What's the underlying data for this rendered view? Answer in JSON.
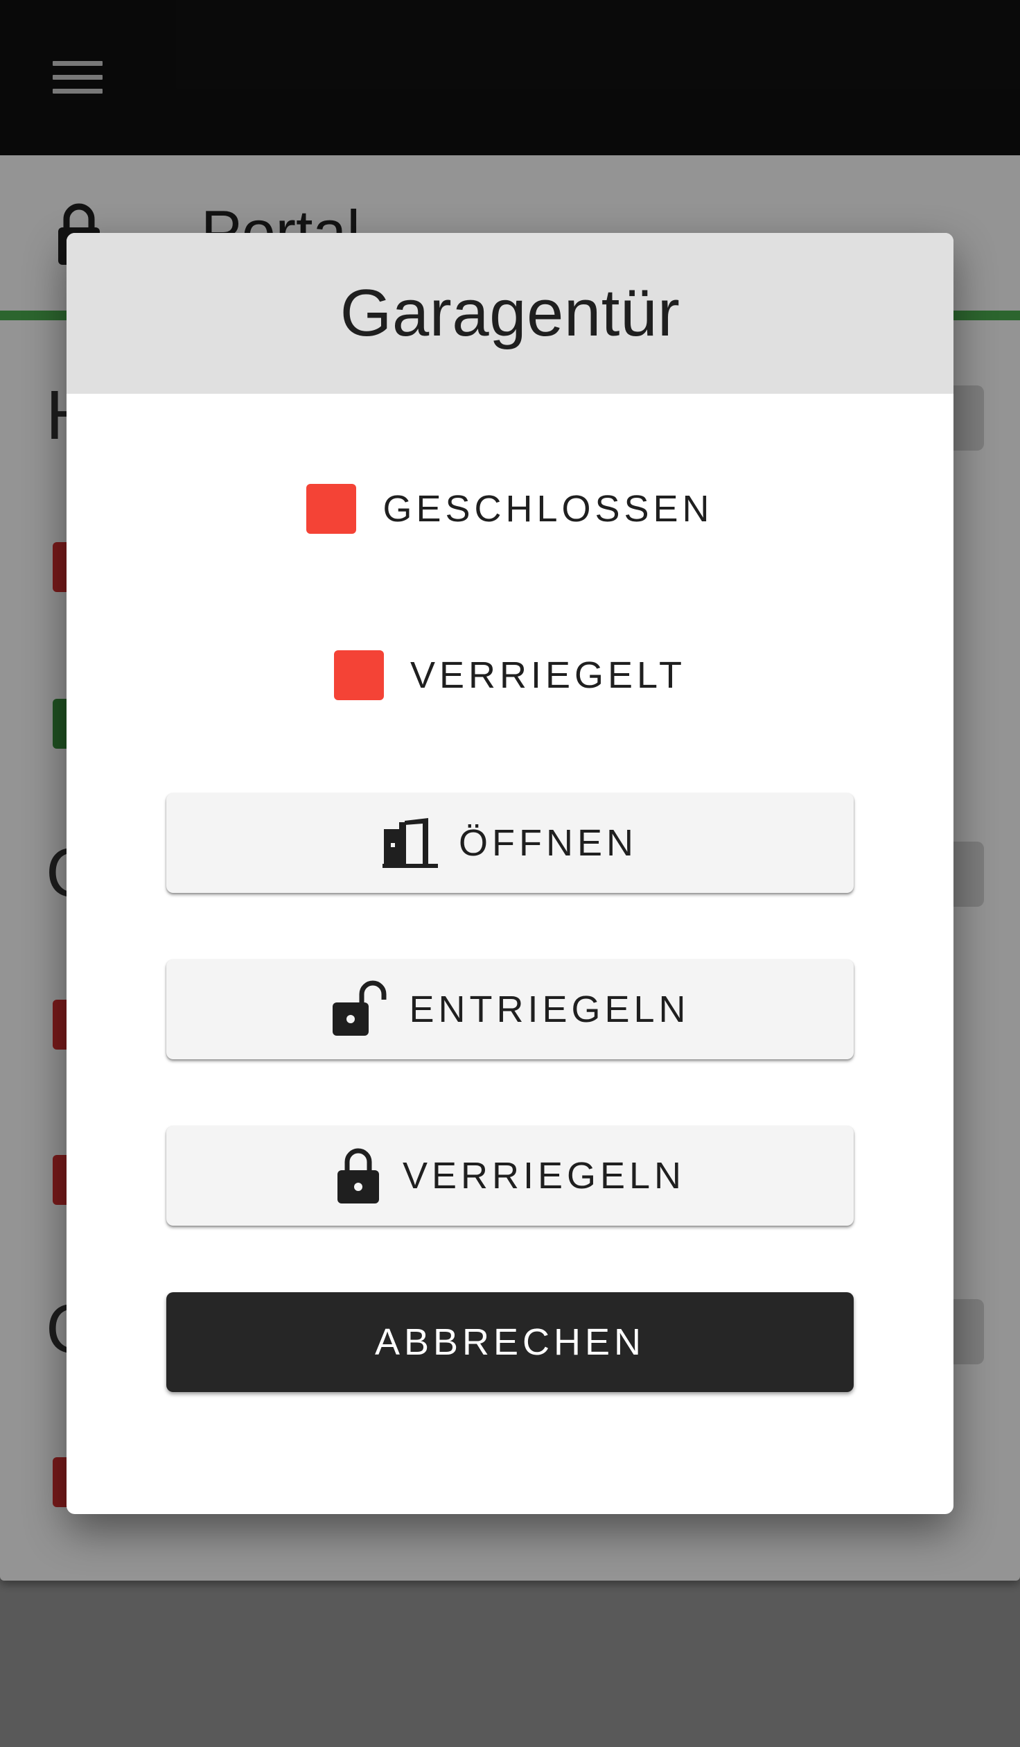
{
  "appbar": {
    "menu_icon": "menu-icon"
  },
  "background": {
    "portal_title": "Portal",
    "portal_icon": "lock-icon",
    "section_letters": [
      "H",
      "C",
      "C"
    ],
    "colors": {
      "divider": "#4caf50",
      "red": "#d32f2f",
      "green": "#388e3c"
    }
  },
  "dialog": {
    "title": "Garagentür",
    "statuses": [
      {
        "label": "GESCHLOSSEN",
        "color": "#f44336"
      },
      {
        "label": "VERRIEGELT",
        "color": "#f44336"
      }
    ],
    "actions": [
      {
        "label": "ÖFFNEN",
        "icon": "door-open-icon"
      },
      {
        "label": "ENTRIEGELN",
        "icon": "lock-open-icon"
      },
      {
        "label": "VERRIEGELN",
        "icon": "lock-icon"
      }
    ],
    "cancel_label": "ABBRECHEN"
  }
}
